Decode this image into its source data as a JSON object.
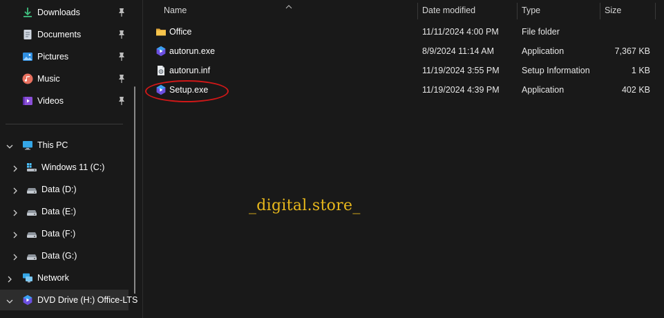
{
  "sidebar": {
    "quick_access": [
      {
        "label": "Downloads",
        "icon": "download-icon"
      },
      {
        "label": "Documents",
        "icon": "documents-icon"
      },
      {
        "label": "Pictures",
        "icon": "pictures-icon"
      },
      {
        "label": "Music",
        "icon": "music-icon"
      },
      {
        "label": "Videos",
        "icon": "videos-icon"
      }
    ],
    "this_pc": {
      "label": "This PC",
      "icon": "monitor-icon"
    },
    "drives": [
      {
        "label": "Windows 11 (C:)",
        "icon": "windows-drive-icon"
      },
      {
        "label": "Data (D:)",
        "icon": "drive-icon"
      },
      {
        "label": "Data (E:)",
        "icon": "drive-icon"
      },
      {
        "label": "Data (F:)",
        "icon": "drive-icon"
      },
      {
        "label": "Data (G:)",
        "icon": "drive-icon"
      }
    ],
    "network": {
      "label": "Network",
      "icon": "network-icon"
    },
    "dvd": {
      "label": "DVD Drive (H:) Office-LTS",
      "icon": "dvd-office-icon"
    }
  },
  "columns": {
    "name": "Name",
    "date": "Date modified",
    "type": "Type",
    "size": "Size"
  },
  "files": [
    {
      "name": "Office",
      "date": "11/11/2024 4:00 PM",
      "type": "File folder",
      "size": "",
      "icon": "folder-icon"
    },
    {
      "name": "autorun.exe",
      "date": "8/9/2024 11:14 AM",
      "type": "Application",
      "size": "7,367 KB",
      "icon": "app-icon"
    },
    {
      "name": "autorun.inf",
      "date": "11/19/2024 3:55 PM",
      "type": "Setup Information",
      "size": "1 KB",
      "icon": "settings-file-icon"
    },
    {
      "name": "Setup.exe",
      "date": "11/19/2024 4:39 PM",
      "type": "Application",
      "size": "402 KB",
      "icon": "app-icon"
    }
  ],
  "watermark": "_digital.store_",
  "colors": {
    "background": "#191919",
    "highlight_oval": "#d01818",
    "watermark": "#e8b81c"
  }
}
